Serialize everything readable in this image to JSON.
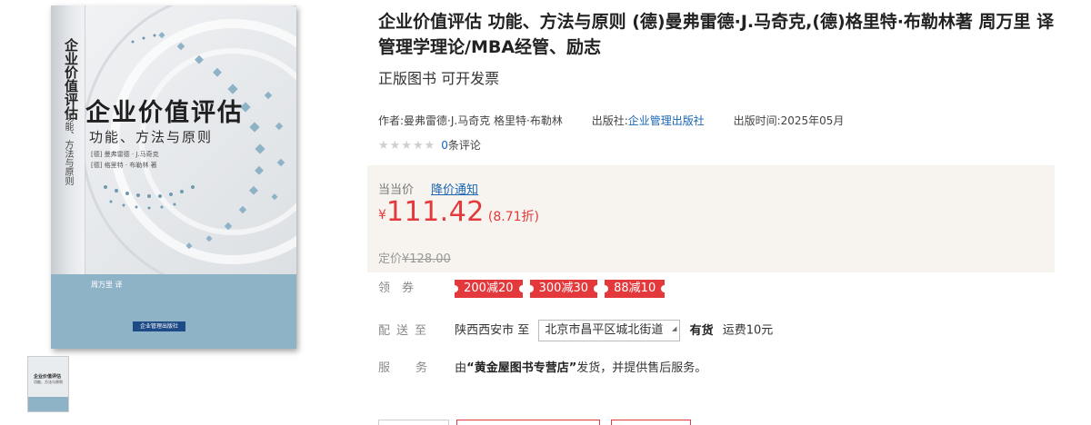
{
  "cover": {
    "spine_title": "企业价值评估",
    "spine_subtitle": "功能、方法与原则",
    "title": "企业价值评估",
    "subtitle": "功能、方法与原则",
    "authors": [
      "[德] 曼弗雷德 · J.马奇克",
      "[德] 格里特 · 布勒林 著"
    ],
    "translator": "周万里 译",
    "publisher": "企业管理出版社"
  },
  "product": {
    "title": "企业价值评估 功能、方法与原则 (德)曼弗雷德·J.马奇克,(德)格里特·布勒林著 周万里 译 管理学理论/MBA经管、励志",
    "subtitle": "正版图书 可开发票",
    "author_label": "作者:",
    "author": "曼弗雷德·J.马奇克 格里特·布勒林",
    "publisher_label": "出版社:",
    "publisher": "企业管理出版社",
    "pubdate_label": "出版时间:",
    "pubdate": "2025年05月",
    "stars": "★★★★★",
    "rating_value": 0,
    "review_count": "0",
    "review_suffix": "条评论"
  },
  "price": {
    "label": "当当价",
    "notice": "降价通知",
    "currency": "¥",
    "current": "111.42",
    "discount": "(8.71折)",
    "list_label": "定价",
    "list_price": "¥128.00"
  },
  "coupons": {
    "label": "领券",
    "items": [
      "200减20",
      "300减30",
      "88减10"
    ]
  },
  "shipping": {
    "label": "配送至",
    "from": "陕西西安市 至",
    "to": "北京市昌平区城北街道",
    "stock": "有货",
    "fee": "运费10元"
  },
  "service": {
    "label": "服务",
    "prefix": "由",
    "shop": "“黄金屋图书专营店”",
    "suffix": "发货，并提供售后服务。"
  },
  "colors": {
    "price_red": "#e4393c",
    "link_blue": "#1a66b3",
    "price_bg": "#f7f4ef",
    "cover_band": "#8fb3c6"
  }
}
